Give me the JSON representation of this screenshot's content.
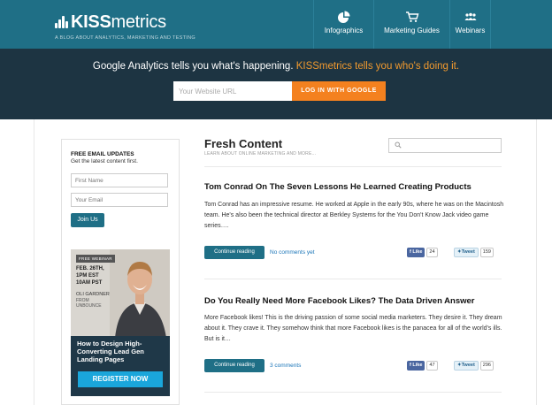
{
  "brand": {
    "logo_bold": "KISS",
    "logo_light": "metrics",
    "tagline": "A BLOG ABOUT ANALYTICS, MARKETING AND TESTING",
    "header_color": "#1f6f86",
    "hero_color": "#1d3442",
    "accent_color": "#f29a2e"
  },
  "nav": {
    "items": [
      {
        "label": "Infographics",
        "icon": "pie-chart-icon"
      },
      {
        "label": "Marketing Guides",
        "icon": "cart-icon"
      },
      {
        "label": "Webinars",
        "icon": "people-icon"
      }
    ]
  },
  "hero": {
    "headline_main": "Google Analytics tells you what's happening. ",
    "headline_accent": "KISSmetrics tells you who's doing it.",
    "url_placeholder": "Your Website URL",
    "login_label": "LOG IN WITH GOOGLE"
  },
  "sidebar": {
    "heading": "FREE EMAIL UPDATES",
    "subheading": "Get the latest content first.",
    "first_name_placeholder": "First Name",
    "email_placeholder": "Your Email",
    "join_label": "Join Us",
    "ad": {
      "badge": "FREE WEBINAR",
      "date_line1": "FEB. 26TH,",
      "date_line2": "1PM EST",
      "date_line3": "10AM PST",
      "presenter_name": "OLI GARDNER",
      "presenter_from": "FROM",
      "presenter_company": "UNBOUNCE",
      "title": "How to Design High-Converting Lead Gen Landing Pages",
      "register_label": "REGISTER NOW"
    }
  },
  "main": {
    "title": "Fresh Content",
    "subtitle": "LEARN ABOUT ONLINE MARKETING AND MORE...",
    "posts": [
      {
        "title": "Tom Conrad On The Seven Lessons He Learned Creating Products",
        "excerpt": "Tom Conrad has an impressive resume. He worked at Apple in the early 90s, where he was on the Macintosh team. He's also been the technical director at Berkley Systems for the You Don't Know Jack video game series….",
        "continue_label": "Continue reading",
        "comments": "No comments yet",
        "like_label": "Like",
        "like_count": "24",
        "tweet_label": "Tweet",
        "tweet_count": "159"
      },
      {
        "title": "Do You Really Need More Facebook Likes? The Data Driven Answer",
        "excerpt": "More Facebook likes! This is the driving passion of some social media marketers. They desire it. They dream about it. They crave it. They somehow think that more Facebook likes is the panacea for all of the world's ills. But is it…",
        "continue_label": "Continue reading",
        "comments": "3 comments",
        "like_label": "Like",
        "like_count": "47",
        "tweet_label": "Tweet",
        "tweet_count": "296"
      }
    ]
  }
}
